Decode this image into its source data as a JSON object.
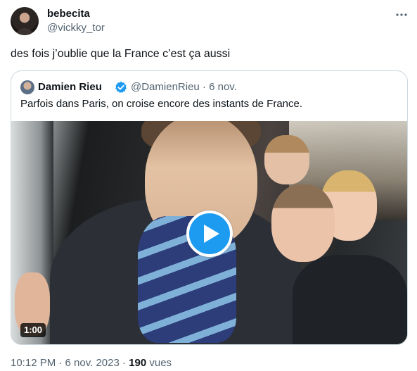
{
  "tweet": {
    "author_name": "bebecita",
    "author_handle": "@vickky_tor",
    "text": "des fois j’oublie que la France c’est ça aussi",
    "more_icon": "more-horizontal-icon"
  },
  "quote": {
    "author_name": "Damien Rieu",
    "verified_icon": "verified-badge-icon",
    "handle_and_date": "@DamienRieu · 6 nov.",
    "text": "Parfois dans Paris, on croise encore des instants de France.",
    "video": {
      "duration": "1:00",
      "play_icon": "play-icon"
    }
  },
  "meta": {
    "timestamp": "10:12 PM · 6 nov. 2023 · ",
    "views_count": "190",
    "views_label": " vues"
  },
  "colors": {
    "accent": "#1d9bf0",
    "secondary_text": "#536471",
    "primary_text": "#0f1419",
    "border": "#cfd9de"
  }
}
